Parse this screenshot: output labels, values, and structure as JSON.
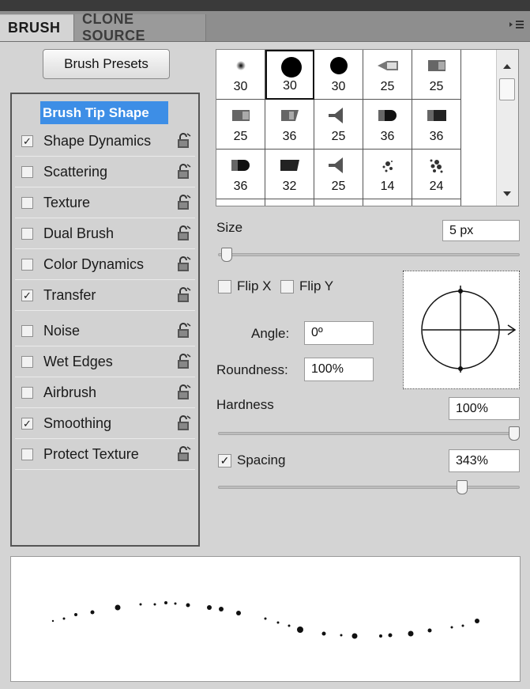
{
  "tabs": [
    {
      "label": "BRUSH",
      "active": true
    },
    {
      "label": "CLONE SOURCE",
      "active": false
    }
  ],
  "panel_menu_icon": "panel-menu-icon",
  "brush_presets_button": "Brush Presets",
  "brush_tip_shape": "Brush Tip Shape",
  "options": [
    {
      "label": "Shape Dynamics",
      "checked": true
    },
    {
      "label": "Scattering",
      "checked": false
    },
    {
      "label": "Texture",
      "checked": false
    },
    {
      "label": "Dual Brush",
      "checked": false
    },
    {
      "label": "Color Dynamics",
      "checked": false
    },
    {
      "label": "Transfer",
      "checked": true
    },
    {
      "label": "Noise",
      "checked": false
    },
    {
      "label": "Wet Edges",
      "checked": false
    },
    {
      "label": "Airbrush",
      "checked": false
    },
    {
      "label": "Smoothing",
      "checked": true
    },
    {
      "label": "Protect Texture",
      "checked": false
    }
  ],
  "brush_tips": [
    {
      "size": "30",
      "icon": "soft-round-small-icon",
      "selected": false
    },
    {
      "size": "30",
      "icon": "hard-round-large-icon",
      "selected": true
    },
    {
      "size": "30",
      "icon": "hard-round-icon",
      "selected": false
    },
    {
      "size": "25",
      "icon": "bristle-tip-icon",
      "selected": false
    },
    {
      "size": "25",
      "icon": "flat-bristle-icon",
      "selected": false
    },
    {
      "size": "25",
      "icon": "flat-bristle-icon",
      "selected": false
    },
    {
      "size": "36",
      "icon": "angled-bristle-icon",
      "selected": false
    },
    {
      "size": "25",
      "icon": "fan-bristle-icon",
      "selected": false
    },
    {
      "size": "36",
      "icon": "round-blunt-icon",
      "selected": false
    },
    {
      "size": "36",
      "icon": "flat-blunt-icon",
      "selected": false
    },
    {
      "size": "36",
      "icon": "round-blunt-icon",
      "selected": false
    },
    {
      "size": "32",
      "icon": "angled-flat-icon",
      "selected": false
    },
    {
      "size": "25",
      "icon": "fan-bristle-icon",
      "selected": false
    },
    {
      "size": "14",
      "icon": "splatter-icon",
      "selected": false
    },
    {
      "size": "24",
      "icon": "splatter-large-icon",
      "selected": false
    }
  ],
  "size": {
    "label": "Size",
    "value": "5 px",
    "slider": 0.01
  },
  "flip_x": {
    "label": "Flip X",
    "checked": false
  },
  "flip_y": {
    "label": "Flip Y",
    "checked": false
  },
  "angle": {
    "label": "Angle:",
    "value": "0º"
  },
  "roundness": {
    "label": "Roundness:",
    "value": "100%"
  },
  "hardness": {
    "label": "Hardness",
    "value": "100%",
    "slider": 1.0
  },
  "spacing": {
    "label": "Spacing",
    "value": "343%",
    "checked": true,
    "slider": 0.82
  }
}
